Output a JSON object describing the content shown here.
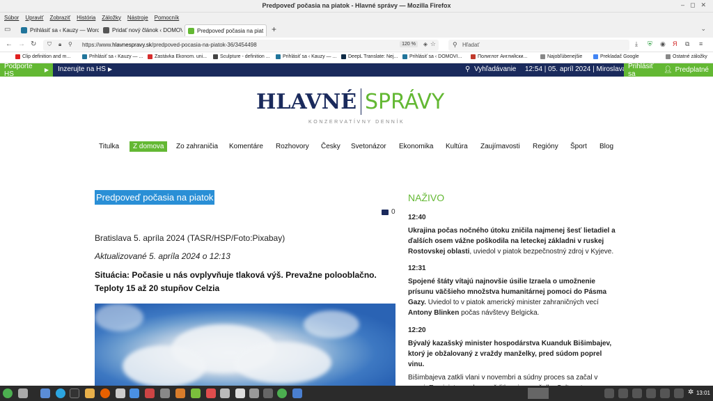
{
  "window": {
    "title": "Predpoveď počasia na piatok - Hlavné správy — Mozilla Firefox"
  },
  "menu": [
    "Súbor",
    "Upraviť",
    "Zobraziť",
    "História",
    "Záložky",
    "Nástroje",
    "Pomocník"
  ],
  "tabs": [
    {
      "label": "Prihlásiť sa ‹ Kauzy — Word",
      "color": "#21759b"
    },
    {
      "label": "Pridať nový článok ‹ DOMOV",
      "color": "#555555"
    },
    {
      "label": "Predpoveď počasia na piat",
      "color": "#63b833"
    }
  ],
  "nav": {
    "url_prefix": "https://www.",
    "url_domain": "hlavnespravy.sk",
    "url_path": "/predpoved-pocasia-na-piatok-36/3454498",
    "zoom": "120 %",
    "search_placeholder": "Hľadať"
  },
  "bookmarks": [
    {
      "label": "Clip definition and m...",
      "color": "#e02020"
    },
    {
      "label": "Prihlásiť sa ‹ Kauzy — ...",
      "color": "#21759b"
    },
    {
      "label": "Zastávka Ekonom. uni...",
      "color": "#d62d2d"
    },
    {
      "label": "Sculpture - definition ...",
      "color": "#444444"
    },
    {
      "label": "Prihlásiť sa ‹ Kauzy — ...",
      "color": "#21759b"
    },
    {
      "label": "DeepL Translate: Nej...",
      "color": "#0f2b46"
    },
    {
      "label": "Prihlásiť sa ‹ DOMOVI...",
      "color": "#21759b"
    },
    {
      "label": "Полиглот Английски...",
      "color": "#c0392b"
    },
    {
      "label": "Najobľúbenejšie",
      "color": "#888888"
    },
    {
      "label": "Prekladač Google",
      "color": "#4285f4"
    },
    {
      "label": "Ostatné záložky",
      "color": "#888888"
    }
  ],
  "sitebar": {
    "support": "Podporte HS",
    "advertise": "Inzerujte na HS",
    "search": "Vyhľadávanie",
    "datetime": "12:54 | 05. apríl 2024 | Miroslava",
    "login": "Prihlásiť sa",
    "subscribe": "Predplatné"
  },
  "logo": {
    "part1": "HLAVNÉ",
    "part2": "SPRÁVY",
    "tagline": "KONZERVATÍVNY DENNÍK"
  },
  "mainnav": [
    "Titulka",
    "Z domova",
    "Zo zahraničia",
    "Komentáre",
    "Rozhovory",
    "Česky",
    "Svetonázor",
    "Ekonomika",
    "Kultúra",
    "Zaujímavosti",
    "Regióny",
    "Šport",
    "Blog"
  ],
  "article": {
    "title": "Predpoveď počasia na piatok",
    "comments": "0",
    "dateline": "Bratislava 5. apríla 2024  (TASR/HSP/Foto:Pixabay)",
    "updated": "Aktualizované 5. apríla 2024 o 12:13",
    "lead": "Situácia: Počasie u nás ovplyvňuje tlaková výš. Prevažne polooblačno. Teploty 15 až 20 stupňov Celzia"
  },
  "live": {
    "heading": "NAŽIVO",
    "items": [
      {
        "time": "12:40",
        "bold": "Ukrajina počas nočného útoku zničila najmenej šesť lietadiel a ďalších osem vážne poškodila na leteckej základni v ruskej Rostovskej oblasti",
        "rest": ", uviedol v piatok bezpečnostný zdroj v Kyjeve."
      },
      {
        "time": "12:31",
        "bold": "Spojené štáty vítajú najnovšie úsilie Izraela o umožnenie prísunu väčšieho množstva humanitárnej pomoci do Pásma Gazy.",
        "rest": " Uviedol to v piatok americký minister zahraničných vecí ",
        "bold2": "Antony Blinken",
        "rest2": " počas návštevy Belgicka."
      },
      {
        "time": "12:20",
        "bold": "Bývalý kazašský minister hospodárstva Kuanduk Bišimbajev, ktorý je obžalovaný z vraždy manželky, pred súdom poprel vinu.",
        "rest": "",
        "para2": "Bišimbajeva zatkli vlani v novembri a súdny proces sa začal v marci. Exminister mal zavraždiť svoju manželku Saltanat Nukenovovú počas"
      }
    ]
  },
  "taskbar": {
    "clock": "13:01"
  }
}
